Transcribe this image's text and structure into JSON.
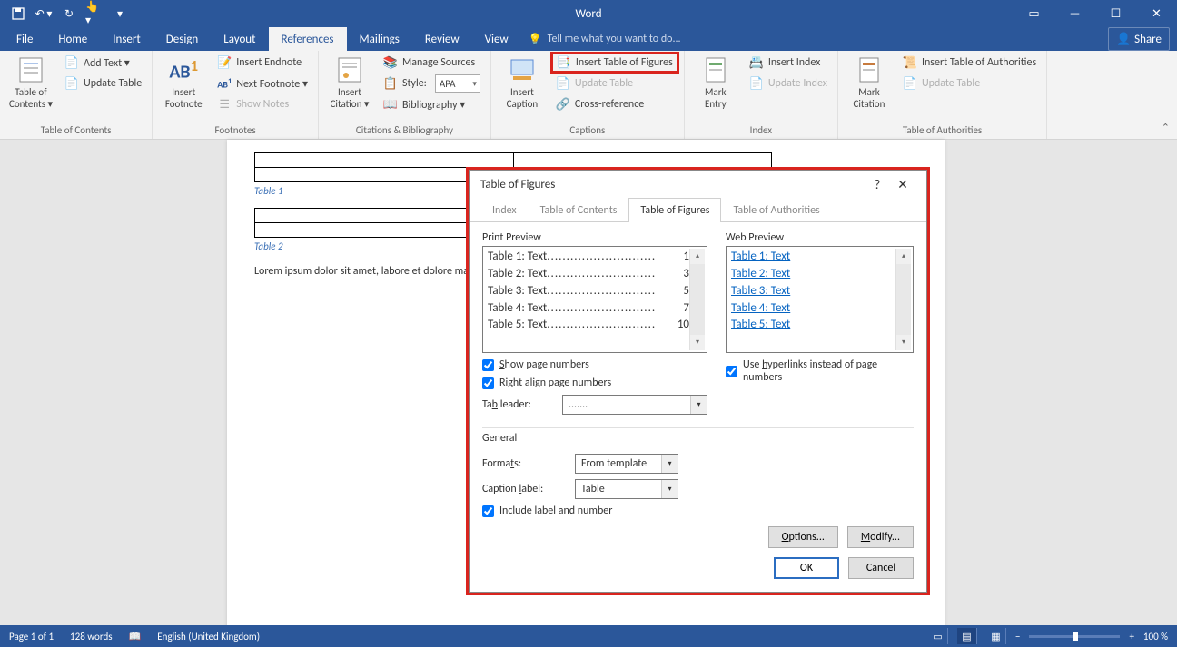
{
  "title": "Word",
  "qat": {
    "save": "💾",
    "undo": "↶",
    "redo": "↻"
  },
  "tabs": [
    "File",
    "Home",
    "Insert",
    "Design",
    "Layout",
    "References",
    "Mailings",
    "Review",
    "View"
  ],
  "tell_me": "Tell me what you want to do...",
  "share": "Share",
  "ribbon": {
    "groups": [
      {
        "label": "Table of Contents",
        "big": {
          "label1": "Table of",
          "label2": "Contents ▾"
        },
        "items": [
          {
            "label": "Add Text ▾"
          },
          {
            "label": "Update Table"
          }
        ]
      },
      {
        "label": "Footnotes",
        "big": {
          "label1": "Insert",
          "label2": "Footnote"
        },
        "items": [
          {
            "label": "Insert Endnote"
          },
          {
            "label": "Next Footnote ▾"
          },
          {
            "label": "Show Notes",
            "disabled": true
          }
        ]
      },
      {
        "label": "Citations & Bibliography",
        "big": {
          "label1": "Insert",
          "label2": "Citation ▾"
        },
        "items": [
          {
            "label": "Manage Sources"
          },
          {
            "label": "Style:",
            "combo": "APA"
          },
          {
            "label": "Bibliography ▾"
          }
        ]
      },
      {
        "label": "Captions",
        "big": {
          "label1": "Insert",
          "label2": "Caption"
        },
        "items": [
          {
            "label": "Insert Table of Figures",
            "highlight": true
          },
          {
            "label": "Update Table",
            "disabled": true
          },
          {
            "label": "Cross-reference"
          }
        ]
      },
      {
        "label": "Index",
        "big": {
          "label1": "Mark",
          "label2": "Entry"
        },
        "items": [
          {
            "label": "Insert Index"
          },
          {
            "label": "Update Index",
            "disabled": true
          }
        ]
      },
      {
        "label": "Table of Authorities",
        "big": {
          "label1": "Mark",
          "label2": "Citation"
        },
        "items": [
          {
            "label": "Insert Table of Authorities"
          },
          {
            "label": "Update Table",
            "disabled": true
          }
        ]
      }
    ]
  },
  "doc": {
    "caption1": "Table 1",
    "caption2": "Table 2",
    "body": "Lorem ipsum dolor sit amet, labore et dolore magna aliqu"
  },
  "dialog": {
    "title": "Table of Figures",
    "tabs": [
      "Index",
      "Table of Contents",
      "Table of Figures",
      "Table of Authorities"
    ],
    "active_tab": "Table of Figures",
    "print_preview_label": "Print Preview",
    "web_preview_label": "Web Preview",
    "print_items": [
      {
        "text": "Table 1: Text",
        "page": "1"
      },
      {
        "text": "Table 2: Text",
        "page": "3"
      },
      {
        "text": "Table 3: Text",
        "page": "5"
      },
      {
        "text": "Table 4: Text",
        "page": "7"
      },
      {
        "text": "Table 5: Text",
        "page": "10"
      }
    ],
    "web_items": [
      "Table 1: Text",
      "Table 2: Text",
      "Table 3: Text",
      "Table 4: Text",
      "Table 5: Text"
    ],
    "show_page_numbers": "Show page numbers",
    "right_align": "Right align page numbers",
    "use_hyperlinks": "Use hyperlinks instead of page numbers",
    "tab_leader_label": "Tab leader:",
    "tab_leader_value": ".......",
    "general_label": "General",
    "formats_label": "Formats:",
    "formats_value": "From template",
    "caption_label_label": "Caption label:",
    "caption_label_value": "Table",
    "include_label_number": "Include label and number",
    "options_btn": "Options...",
    "modify_btn": "Modify...",
    "ok_btn": "OK",
    "cancel_btn": "Cancel"
  },
  "status": {
    "page": "Page 1 of 1",
    "words": "128 words",
    "lang": "English (United Kingdom)",
    "zoom": "100 %"
  }
}
